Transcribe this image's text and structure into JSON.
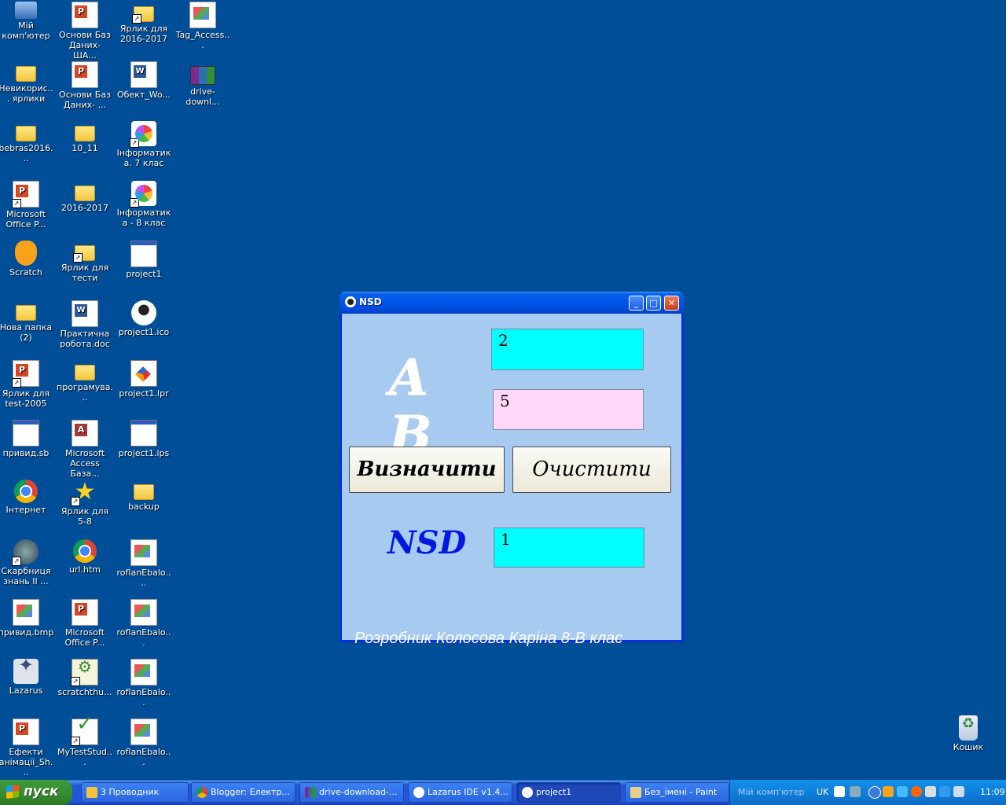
{
  "desktop": {
    "icons": [
      {
        "label": "Мій комп'ютер",
        "icon": "computer-icon"
      },
      {
        "label": "Основи Баз Даних- ША...",
        "icon": "powerpoint-icon"
      },
      {
        "label": "Ярлик для 2016-2017",
        "icon": "folder-icon"
      },
      {
        "label": "Tag_Access...",
        "icon": "image-icon"
      },
      {
        "label": "Невикорис... ярлики",
        "icon": "folder-icon"
      },
      {
        "label": "Основи Баз Даних- ...",
        "icon": "powerpoint-icon"
      },
      {
        "label": "Обект_Wo...",
        "icon": "word-icon"
      },
      {
        "label": "drive-downl...",
        "icon": "winrar-icon"
      },
      {
        "label": "bebras2016...",
        "icon": "folder-icon"
      },
      {
        "label": "10_11",
        "icon": "folder-icon"
      },
      {
        "label": "Інформатика. 7 клас",
        "icon": "app-icon"
      },
      {
        "label": "Microsoft Office P...",
        "icon": "powerpoint-icon"
      },
      {
        "label": "2016-2017",
        "icon": "folder-icon"
      },
      {
        "label": "Інформатика - 8 клас",
        "icon": "app-icon"
      },
      {
        "label": "Scratch",
        "icon": "scratch-icon"
      },
      {
        "label": "Ярлик для тести",
        "icon": "folder-icon"
      },
      {
        "label": "project1",
        "icon": "exe-icon"
      },
      {
        "label": "Нова папка (2)",
        "icon": "folder-icon"
      },
      {
        "label": "Практична робота.doc",
        "icon": "word-icon"
      },
      {
        "label": "project1.ico",
        "icon": "paw-icon"
      },
      {
        "label": "Ярлик для test-2005",
        "icon": "test-icon"
      },
      {
        "label": "програмува...",
        "icon": "folder-icon"
      },
      {
        "label": "project1.lpr",
        "icon": "lazarus-source-icon"
      },
      {
        "label": "привид.sb",
        "icon": "exe-icon"
      },
      {
        "label": "Microsoft Access База...",
        "icon": "access-icon"
      },
      {
        "label": "project1.lps",
        "icon": "exe-icon"
      },
      {
        "label": "Інтернет",
        "icon": "chrome-icon"
      },
      {
        "label": "Ярлик для 5-8",
        "icon": "star-icon"
      },
      {
        "label": "backup",
        "icon": "folder-icon"
      },
      {
        "label": "Скарбниця знань II ...",
        "icon": "flash-icon"
      },
      {
        "label": "url.htm",
        "icon": "chrome-icon"
      },
      {
        "label": "roflanEbalo....",
        "icon": "image-icon"
      },
      {
        "label": "привид.bmp",
        "icon": "image-icon"
      },
      {
        "label": "Microsoft Office P...",
        "icon": "powerpoint-icon"
      },
      {
        "label": "roflanEbalo...",
        "icon": "image-icon"
      },
      {
        "label": "Lazarus",
        "icon": "lazarus-icon"
      },
      {
        "label": "scratchthu...",
        "icon": "scratch-thumb-icon"
      },
      {
        "label": "roflanEbalo...",
        "icon": "image-icon"
      },
      {
        "label": "Ефекти анімації_Sh...",
        "icon": "powerpoint-icon"
      },
      {
        "label": "MyTestStud...",
        "icon": "mytest-icon"
      },
      {
        "label": "roflanEbalo...",
        "icon": "image-icon"
      },
      {
        "label": "Кошик",
        "icon": "recycle-bin-icon"
      }
    ]
  },
  "window": {
    "title": "NSD",
    "label_a": "A",
    "label_b": "B",
    "input_a": "2",
    "input_b": "5",
    "button_calc": "Визначити",
    "button_clear": "Очистити",
    "result_label": "NSD",
    "result_value": "1",
    "author": "Розробник Колосова Каріна 8-В клас",
    "colors": {
      "input_a": "#00ffff",
      "input_b": "#ffd8f8",
      "result": "#00ffff",
      "client": "#a6caf0"
    }
  },
  "taskbar": {
    "start_label": "пуск",
    "tasks": [
      {
        "label": "3 Проводник"
      },
      {
        "label": "Blogger: Електр..."
      },
      {
        "label": "drive-download-..."
      },
      {
        "label": "Lazarus IDE v1.4..."
      },
      {
        "label": "project1"
      },
      {
        "label": "Без_імені - Paint"
      }
    ],
    "tray": {
      "computer_label": "Мій комп'ютер",
      "lang": "UK",
      "clock": "11:09"
    }
  }
}
